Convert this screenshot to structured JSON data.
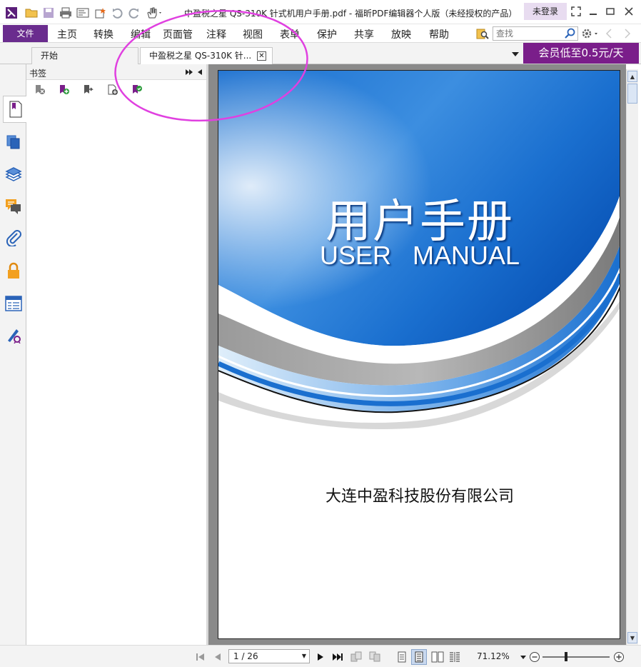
{
  "window": {
    "title": "中盈税之星 QS-310K 针式机用户手册.pdf - 福昕PDF编辑器个人版（未经授权的产品）",
    "login_label": "未登录"
  },
  "menu": {
    "file": "文件",
    "items": [
      "主页",
      "转换",
      "编辑",
      "页面管",
      "注释",
      "视图",
      "表单",
      "保护",
      "共享",
      "放映",
      "帮助"
    ]
  },
  "search": {
    "placeholder": "查找"
  },
  "tabs": [
    {
      "label": "开始"
    },
    {
      "label": "中盈税之星 QS-310K 针..."
    }
  ],
  "promo": "会员低至0.5元/天",
  "bookmark_panel": {
    "title": "书签"
  },
  "document": {
    "title_cn": "用户手册",
    "title_en": "USER   MANUAL",
    "company": "大连中盈科技股份有限公司"
  },
  "statusbar": {
    "page_indicator": "1 / 26",
    "zoom": "71.12%"
  },
  "colors": {
    "brand_purple": "#6a2c8e",
    "promo_purple": "#7a1e8a",
    "annotation_magenta": "#e040e0",
    "cover_blue": "#1a6fcf"
  }
}
